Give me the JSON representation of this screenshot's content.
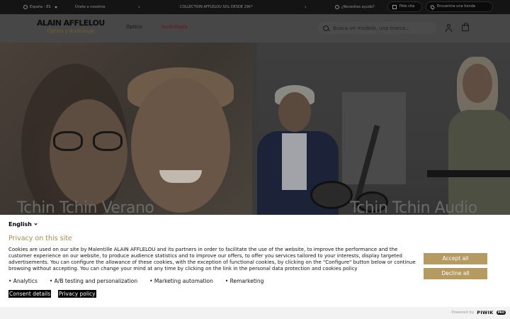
{
  "topbar": {
    "language": "España - ES",
    "login": "Únete a nosotros",
    "promo": "COLLECTION AFFLELOU SOL DESDE 29€*",
    "promo_prev": "‹",
    "promo_next": "›",
    "help": "¿Necesitas ayuda?",
    "appointment": "Pide cita",
    "store_finder": "Encuentra una tienda"
  },
  "header": {
    "logo_main": "ALAIN AFFLELOU",
    "logo_sub": "Óptico y Audiólogo",
    "nav": [
      "Óptico",
      "Audiología"
    ],
    "search_placeholder": "Busca un modelo, una marca..."
  },
  "hero": {
    "left_title": "Tchin Tchin Verano",
    "right_title": "Tchin Tchin Audio"
  },
  "consent": {
    "language": "English",
    "title": "Privacy on this site",
    "text": "Cookies are used on our site by Malentille ALAIN AFFLELOU and its partners in order to facilitate the use of the website, to improve the performance and the customer experience on our website, to produce audience statistics and to improve our offers, to offer you services tailored to your interests, display targeted advertisements. You can configure the allowance of these cookies, with the exception of functional cookies, by clicking on the \"Configure\" button below or continue browsing without accepting. You can change your mind at any time by clicking on the link in the personal data protection and cookies policy",
    "purposes": [
      "• Analytics",
      "• A/B testing and personalization",
      "• Marketing automation",
      "• Remarketing"
    ],
    "consent_details": "Consent details",
    "privacy_policy": "Privacy policy",
    "accept": "Accept all",
    "decline": "Decline all",
    "powered_by": "Powered by",
    "brand": "PIWIK",
    "brand_badge": "PRO"
  },
  "colors": {
    "accent_gold": "#b59a62",
    "title_gold": "#a88a4a",
    "audio_nav": "#6e1020"
  }
}
